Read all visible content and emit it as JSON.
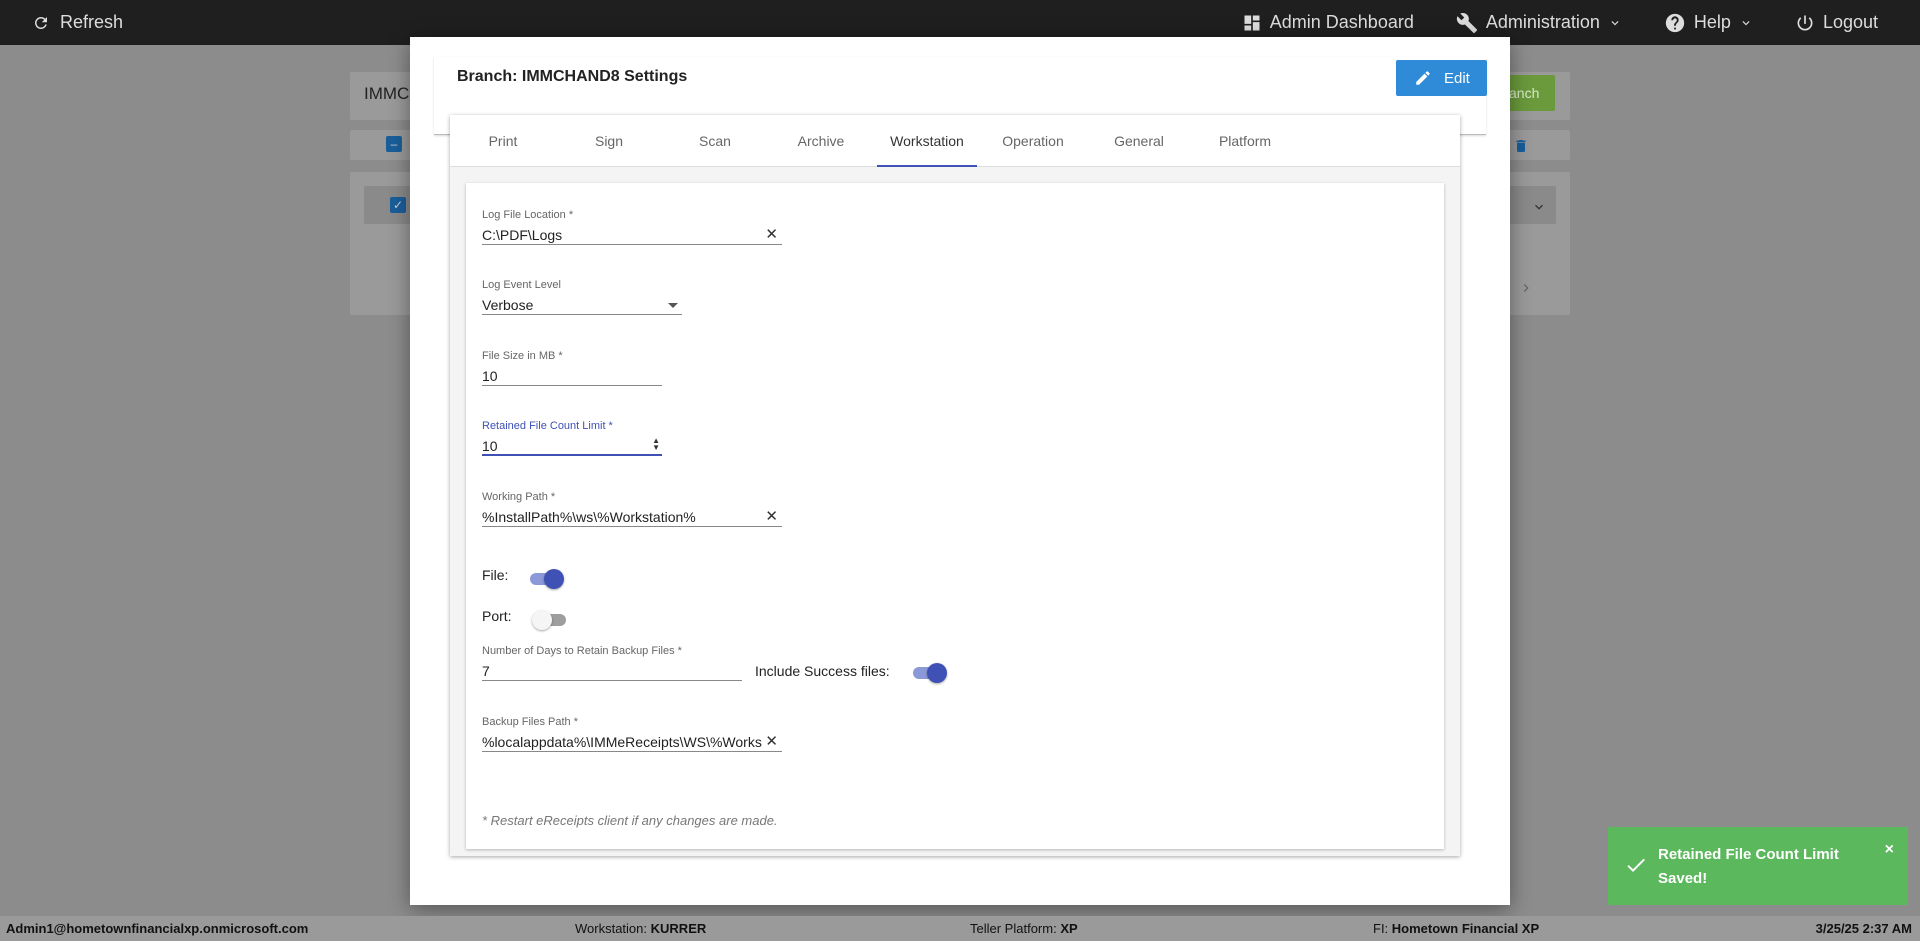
{
  "topbar": {
    "refresh_label": "Refresh",
    "admin_dashboard_label": "Admin Dashboard",
    "administration_label": "Administration",
    "help_label": "Help",
    "logout_label": "Logout"
  },
  "background": {
    "search_value": "IMMCI",
    "add_branch_label": "anch"
  },
  "modal": {
    "title": "Branch: IMMCHAND8 Settings",
    "edit_label": "Edit",
    "tabs": [
      {
        "label": "Print"
      },
      {
        "label": "Sign"
      },
      {
        "label": "Scan"
      },
      {
        "label": "Archive"
      },
      {
        "label": "Workstation"
      },
      {
        "label": "Operation"
      },
      {
        "label": "General"
      },
      {
        "label": "Platform"
      }
    ],
    "active_tab": "Workstation",
    "fields": {
      "log_file_location": {
        "label": "Log File Location *",
        "value": "C:\\PDF\\Logs"
      },
      "log_event_level": {
        "label": "Log Event Level",
        "value": "Verbose"
      },
      "file_size": {
        "label": "File Size in MB *",
        "value": "10"
      },
      "retained_count": {
        "label": "Retained File Count Limit *",
        "value": "10"
      },
      "working_path": {
        "label": "Working Path *",
        "value": "%InstallPath%\\ws\\%Workstation%"
      },
      "file_toggle": {
        "label": "File:",
        "on": true
      },
      "port_toggle": {
        "label": "Port:",
        "on": false
      },
      "retain_days": {
        "label": "Number of Days to Retain Backup Files *",
        "value": "7"
      },
      "include_success": {
        "label": "Include Success files:",
        "on": true
      },
      "backup_path": {
        "label": "Backup Files Path *",
        "value": "%localappdata%\\IMMeReceipts\\WS\\%Works"
      }
    },
    "note": "* Restart eReceipts client if any changes are made."
  },
  "toast": {
    "message": "Retained File Count Limit Saved!",
    "close": "×"
  },
  "footer": {
    "user": "Admin1@hometownfinancialxp.onmicrosoft.com",
    "workstation_label": "Workstation:",
    "workstation_value": "KURRER",
    "teller_label": "Teller Platform:",
    "teller_value": "XP",
    "fi_label": "FI:",
    "fi_value": "Hometown Financial XP",
    "datetime": "3/25/25 2:37 AM"
  },
  "colors": {
    "primary": "#3f51b5",
    "edit_button": "#2f8ad8",
    "toast": "#5bb85d",
    "topbar": "#1f1f1f"
  }
}
